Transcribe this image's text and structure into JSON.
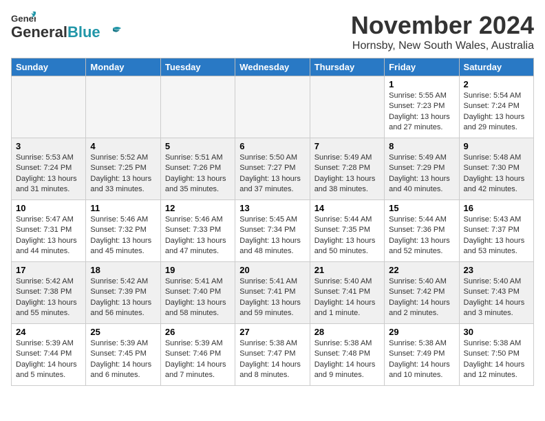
{
  "header": {
    "logo_general": "General",
    "logo_blue": "Blue",
    "month_title": "November 2024",
    "location": "Hornsby, New South Wales, Australia"
  },
  "weekdays": [
    "Sunday",
    "Monday",
    "Tuesday",
    "Wednesday",
    "Thursday",
    "Friday",
    "Saturday"
  ],
  "weeks": [
    [
      {
        "day": "",
        "info": ""
      },
      {
        "day": "",
        "info": ""
      },
      {
        "day": "",
        "info": ""
      },
      {
        "day": "",
        "info": ""
      },
      {
        "day": "",
        "info": ""
      },
      {
        "day": "1",
        "info": "Sunrise: 5:55 AM\nSunset: 7:23 PM\nDaylight: 13 hours\nand 27 minutes."
      },
      {
        "day": "2",
        "info": "Sunrise: 5:54 AM\nSunset: 7:24 PM\nDaylight: 13 hours\nand 29 minutes."
      }
    ],
    [
      {
        "day": "3",
        "info": "Sunrise: 5:53 AM\nSunset: 7:24 PM\nDaylight: 13 hours\nand 31 minutes."
      },
      {
        "day": "4",
        "info": "Sunrise: 5:52 AM\nSunset: 7:25 PM\nDaylight: 13 hours\nand 33 minutes."
      },
      {
        "day": "5",
        "info": "Sunrise: 5:51 AM\nSunset: 7:26 PM\nDaylight: 13 hours\nand 35 minutes."
      },
      {
        "day": "6",
        "info": "Sunrise: 5:50 AM\nSunset: 7:27 PM\nDaylight: 13 hours\nand 37 minutes."
      },
      {
        "day": "7",
        "info": "Sunrise: 5:49 AM\nSunset: 7:28 PM\nDaylight: 13 hours\nand 38 minutes."
      },
      {
        "day": "8",
        "info": "Sunrise: 5:49 AM\nSunset: 7:29 PM\nDaylight: 13 hours\nand 40 minutes."
      },
      {
        "day": "9",
        "info": "Sunrise: 5:48 AM\nSunset: 7:30 PM\nDaylight: 13 hours\nand 42 minutes."
      }
    ],
    [
      {
        "day": "10",
        "info": "Sunrise: 5:47 AM\nSunset: 7:31 PM\nDaylight: 13 hours\nand 44 minutes."
      },
      {
        "day": "11",
        "info": "Sunrise: 5:46 AM\nSunset: 7:32 PM\nDaylight: 13 hours\nand 45 minutes."
      },
      {
        "day": "12",
        "info": "Sunrise: 5:46 AM\nSunset: 7:33 PM\nDaylight: 13 hours\nand 47 minutes."
      },
      {
        "day": "13",
        "info": "Sunrise: 5:45 AM\nSunset: 7:34 PM\nDaylight: 13 hours\nand 48 minutes."
      },
      {
        "day": "14",
        "info": "Sunrise: 5:44 AM\nSunset: 7:35 PM\nDaylight: 13 hours\nand 50 minutes."
      },
      {
        "day": "15",
        "info": "Sunrise: 5:44 AM\nSunset: 7:36 PM\nDaylight: 13 hours\nand 52 minutes."
      },
      {
        "day": "16",
        "info": "Sunrise: 5:43 AM\nSunset: 7:37 PM\nDaylight: 13 hours\nand 53 minutes."
      }
    ],
    [
      {
        "day": "17",
        "info": "Sunrise: 5:42 AM\nSunset: 7:38 PM\nDaylight: 13 hours\nand 55 minutes."
      },
      {
        "day": "18",
        "info": "Sunrise: 5:42 AM\nSunset: 7:39 PM\nDaylight: 13 hours\nand 56 minutes."
      },
      {
        "day": "19",
        "info": "Sunrise: 5:41 AM\nSunset: 7:40 PM\nDaylight: 13 hours\nand 58 minutes."
      },
      {
        "day": "20",
        "info": "Sunrise: 5:41 AM\nSunset: 7:41 PM\nDaylight: 13 hours\nand 59 minutes."
      },
      {
        "day": "21",
        "info": "Sunrise: 5:40 AM\nSunset: 7:41 PM\nDaylight: 14 hours\nand 1 minute."
      },
      {
        "day": "22",
        "info": "Sunrise: 5:40 AM\nSunset: 7:42 PM\nDaylight: 14 hours\nand 2 minutes."
      },
      {
        "day": "23",
        "info": "Sunrise: 5:40 AM\nSunset: 7:43 PM\nDaylight: 14 hours\nand 3 minutes."
      }
    ],
    [
      {
        "day": "24",
        "info": "Sunrise: 5:39 AM\nSunset: 7:44 PM\nDaylight: 14 hours\nand 5 minutes."
      },
      {
        "day": "25",
        "info": "Sunrise: 5:39 AM\nSunset: 7:45 PM\nDaylight: 14 hours\nand 6 minutes."
      },
      {
        "day": "26",
        "info": "Sunrise: 5:39 AM\nSunset: 7:46 PM\nDaylight: 14 hours\nand 7 minutes."
      },
      {
        "day": "27",
        "info": "Sunrise: 5:38 AM\nSunset: 7:47 PM\nDaylight: 14 hours\nand 8 minutes."
      },
      {
        "day": "28",
        "info": "Sunrise: 5:38 AM\nSunset: 7:48 PM\nDaylight: 14 hours\nand 9 minutes."
      },
      {
        "day": "29",
        "info": "Sunrise: 5:38 AM\nSunset: 7:49 PM\nDaylight: 14 hours\nand 10 minutes."
      },
      {
        "day": "30",
        "info": "Sunrise: 5:38 AM\nSunset: 7:50 PM\nDaylight: 14 hours\nand 12 minutes."
      }
    ]
  ]
}
